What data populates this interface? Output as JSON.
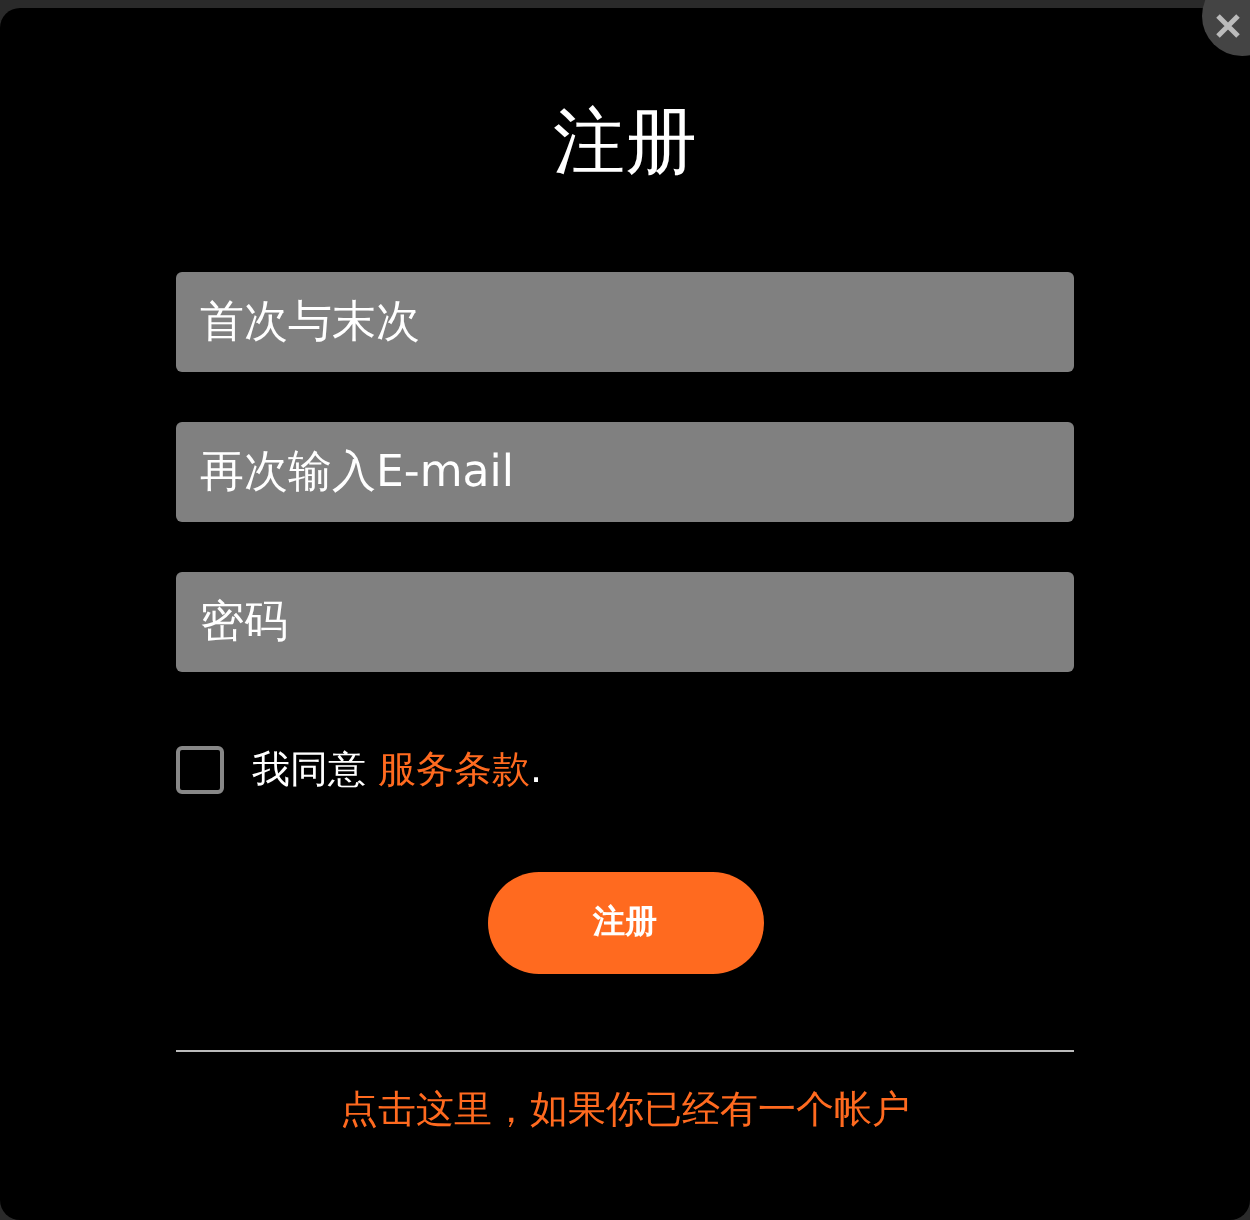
{
  "dialog": {
    "title": "注册",
    "close_button": {
      "kind": "close"
    }
  },
  "fields": [
    {
      "placeholder": "首次与末次"
    },
    {
      "placeholder": "再次输入E-mail"
    },
    {
      "placeholder": "密码"
    }
  ],
  "agreement": {
    "checked": false,
    "text": "我同意",
    "link": "服务条款",
    "suffix": "."
  },
  "submit_button": "注册",
  "login_link": "点击这里，如果你已经有一个帐户"
}
